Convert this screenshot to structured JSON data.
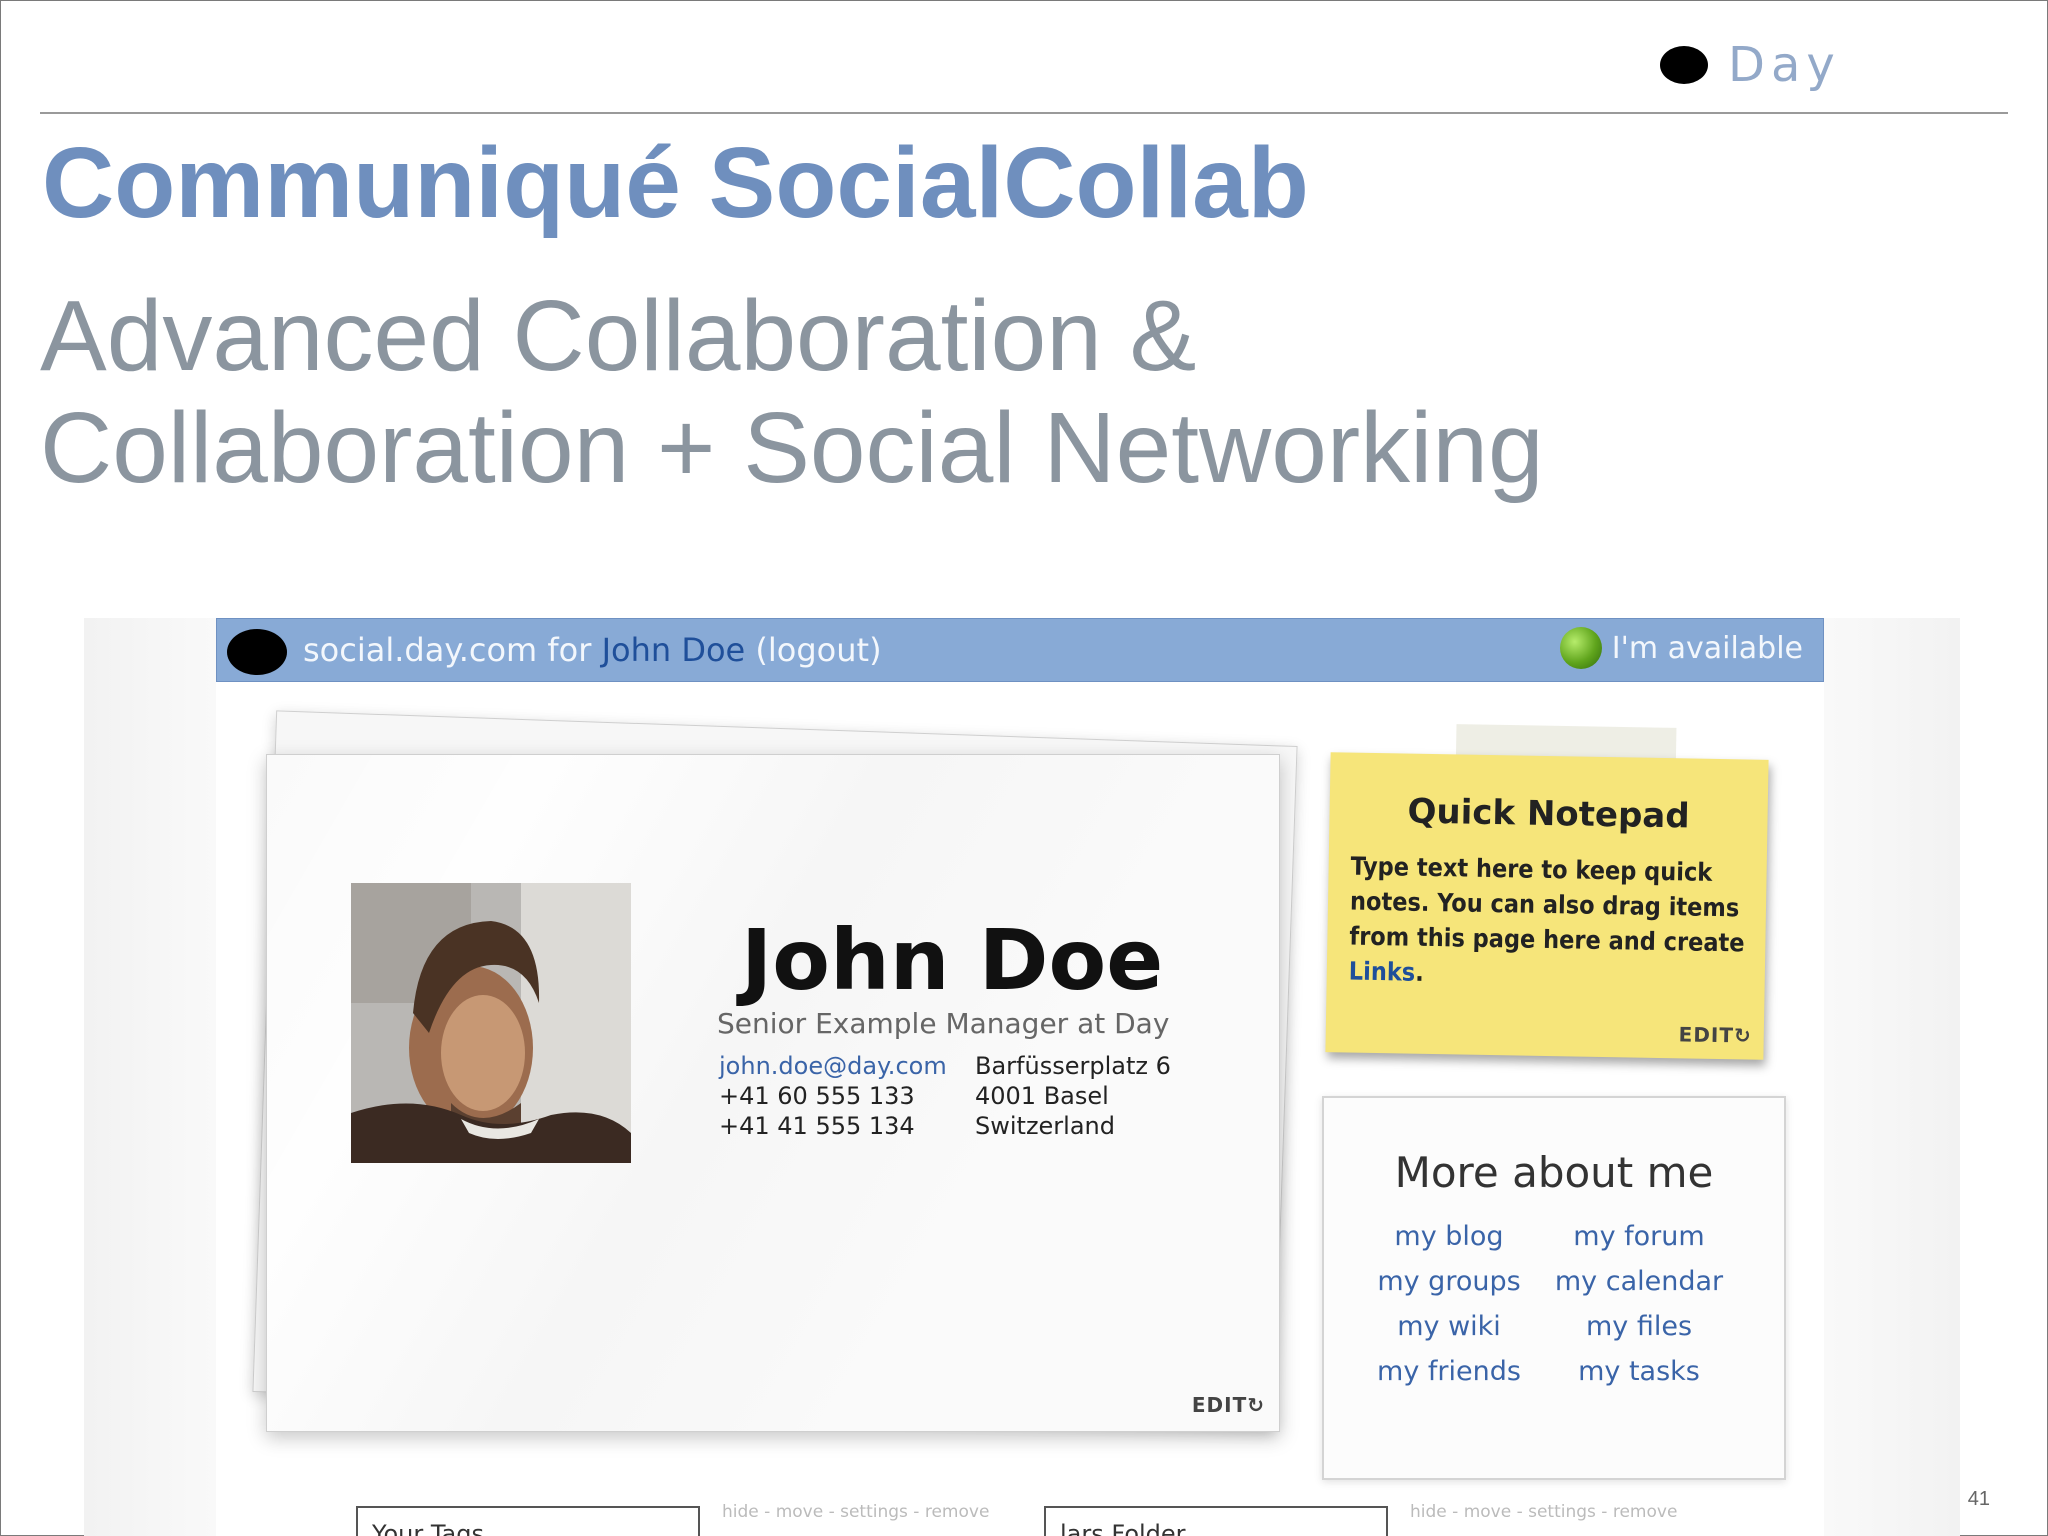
{
  "slide": {
    "logo_text": "Day",
    "title": "Communiqué SocialCollab",
    "subtitle_line1": "Advanced Collaboration &",
    "subtitle_line2": "Collaboration + Social Networking",
    "page_number": "41"
  },
  "app": {
    "header": {
      "site": "social.day.com for ",
      "user": "John Doe",
      "logout": " (logout)",
      "status": "I'm available",
      "status_color": "#5fa41c"
    },
    "profile": {
      "name": "John Doe",
      "role": "Senior Example Manager at Day",
      "email": "john.doe@day.com",
      "phone1": "+41 60 555 133",
      "phone2": "+41 41 555 134",
      "street": "Barfüsserplatz 6",
      "city": "4001 Basel",
      "country": "Switzerland",
      "edit_label": "EDIT"
    },
    "notepad": {
      "title": "Quick Notepad",
      "body": "Type text here to keep quick notes. You can also drag items from this page here and create ",
      "link": "Links",
      "body_end": ".",
      "edit_label": "EDIT"
    },
    "about": {
      "title": "More about me",
      "links": [
        "my blog",
        "my forum",
        "my groups",
        "my calendar",
        "my wiki",
        "my files",
        "my friends",
        "my tasks"
      ]
    },
    "widgets": [
      {
        "label": "Your Tags",
        "tools": "hide - move - settings - remove"
      },
      {
        "label": "lars Folder",
        "tools": "hide - move - settings - remove"
      }
    ]
  }
}
